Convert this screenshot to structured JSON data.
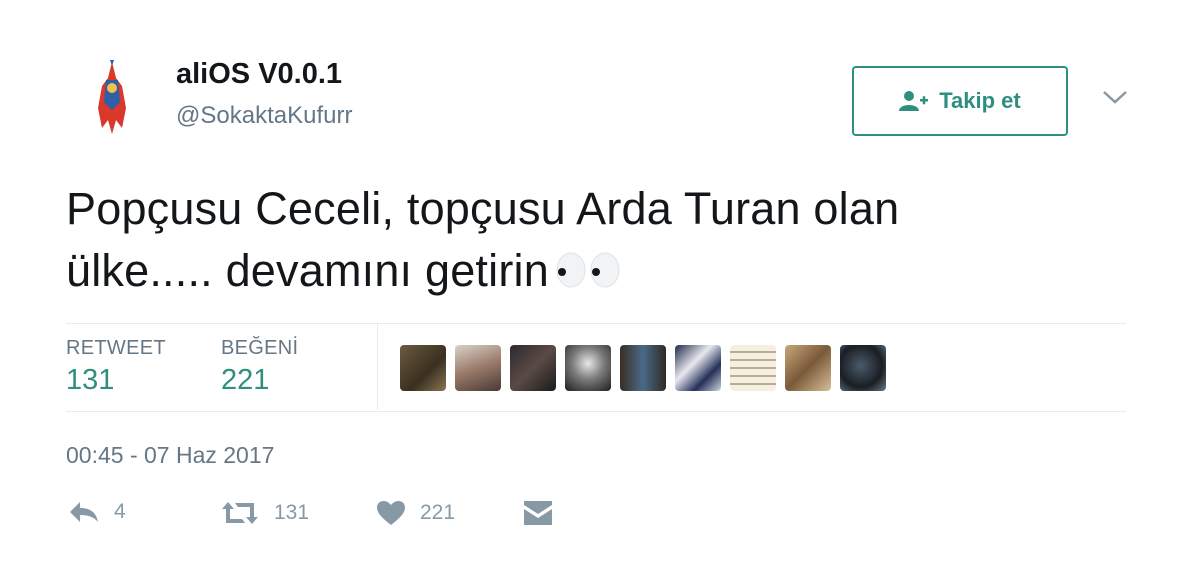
{
  "user": {
    "name": "aliOS V0.0.1",
    "handle": "@SokaktaKufurr"
  },
  "follow_button": {
    "label": "Takip et",
    "icon": "add-user-icon"
  },
  "tweet": {
    "line1": "Popçusu Ceceli, topçusu Arda Turan olan",
    "line2": "ülke..... devamını getirin"
  },
  "stats": {
    "retweet_label": "RETWEET",
    "retweet_count": "131",
    "like_label": "BEĞENİ",
    "like_count": "221"
  },
  "timestamp": "00:45 - 07 Haz 2017",
  "actions": {
    "reply_count": "4",
    "retweet_count": "131",
    "like_count": "221"
  },
  "colors": {
    "accent": "#2f8f7f",
    "muted": "#657786",
    "action": "#8899a6"
  }
}
